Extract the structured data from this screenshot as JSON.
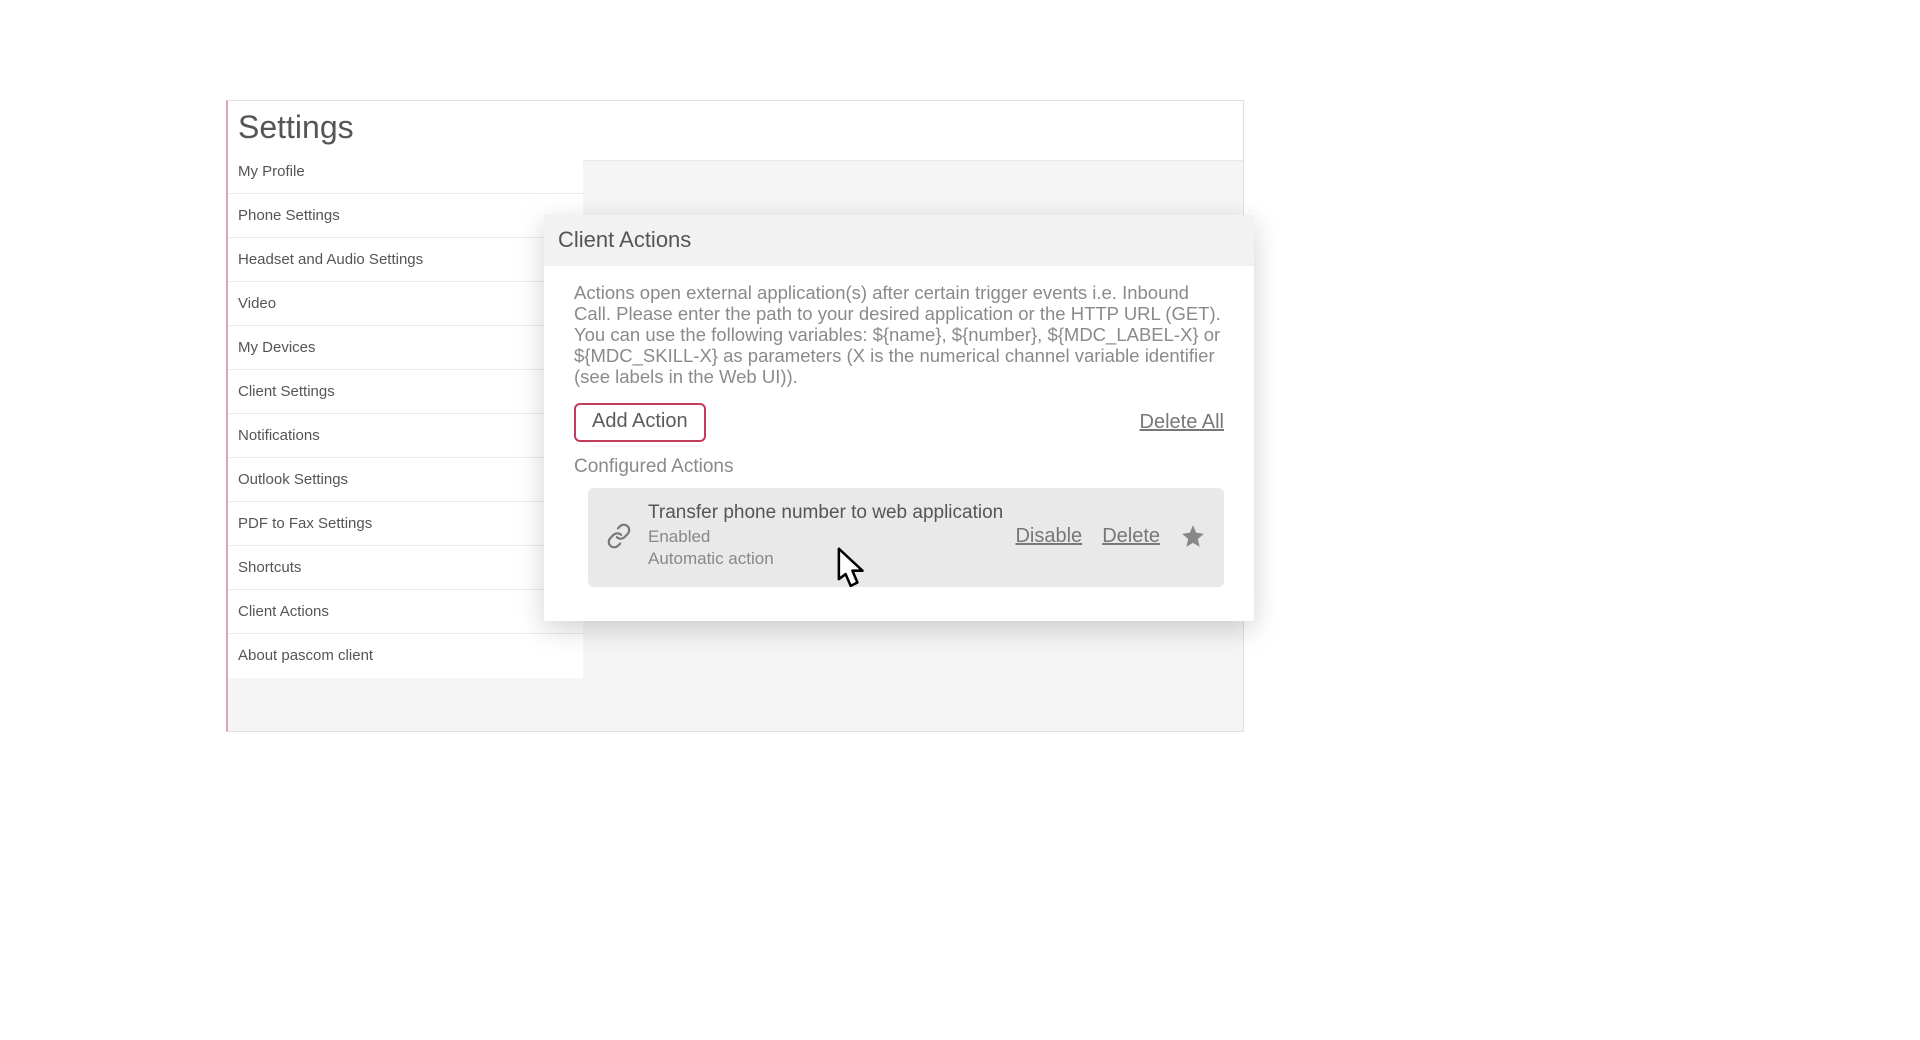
{
  "settings": {
    "title": "Settings",
    "sidebar": [
      "My Profile",
      "Phone Settings",
      "Headset and Audio Settings",
      "Video",
      "My Devices",
      "Client Settings",
      "Notifications",
      "Outlook Settings",
      "PDF to Fax Settings",
      "Shortcuts",
      "Client Actions",
      "About pascom client"
    ]
  },
  "panel": {
    "title": "Client Actions",
    "description": "Actions open external application(s) after certain trigger events i.e. Inbound Call. Please enter the path to your desired application or the HTTP URL (GET). You can use the following variables: ${name}, ${number}, ${MDC_LABEL-X} or ${MDC_SKILL-X} as parameters (X is the numerical channel variable identifier (see labels in the Web UI)).",
    "add_button": "Add Action",
    "delete_all": "Delete All",
    "configured_label": "Configured Actions",
    "action": {
      "title": "Transfer phone number to web application",
      "status": "Enabled",
      "type": "Automatic action",
      "disable": "Disable",
      "delete": "Delete"
    }
  }
}
